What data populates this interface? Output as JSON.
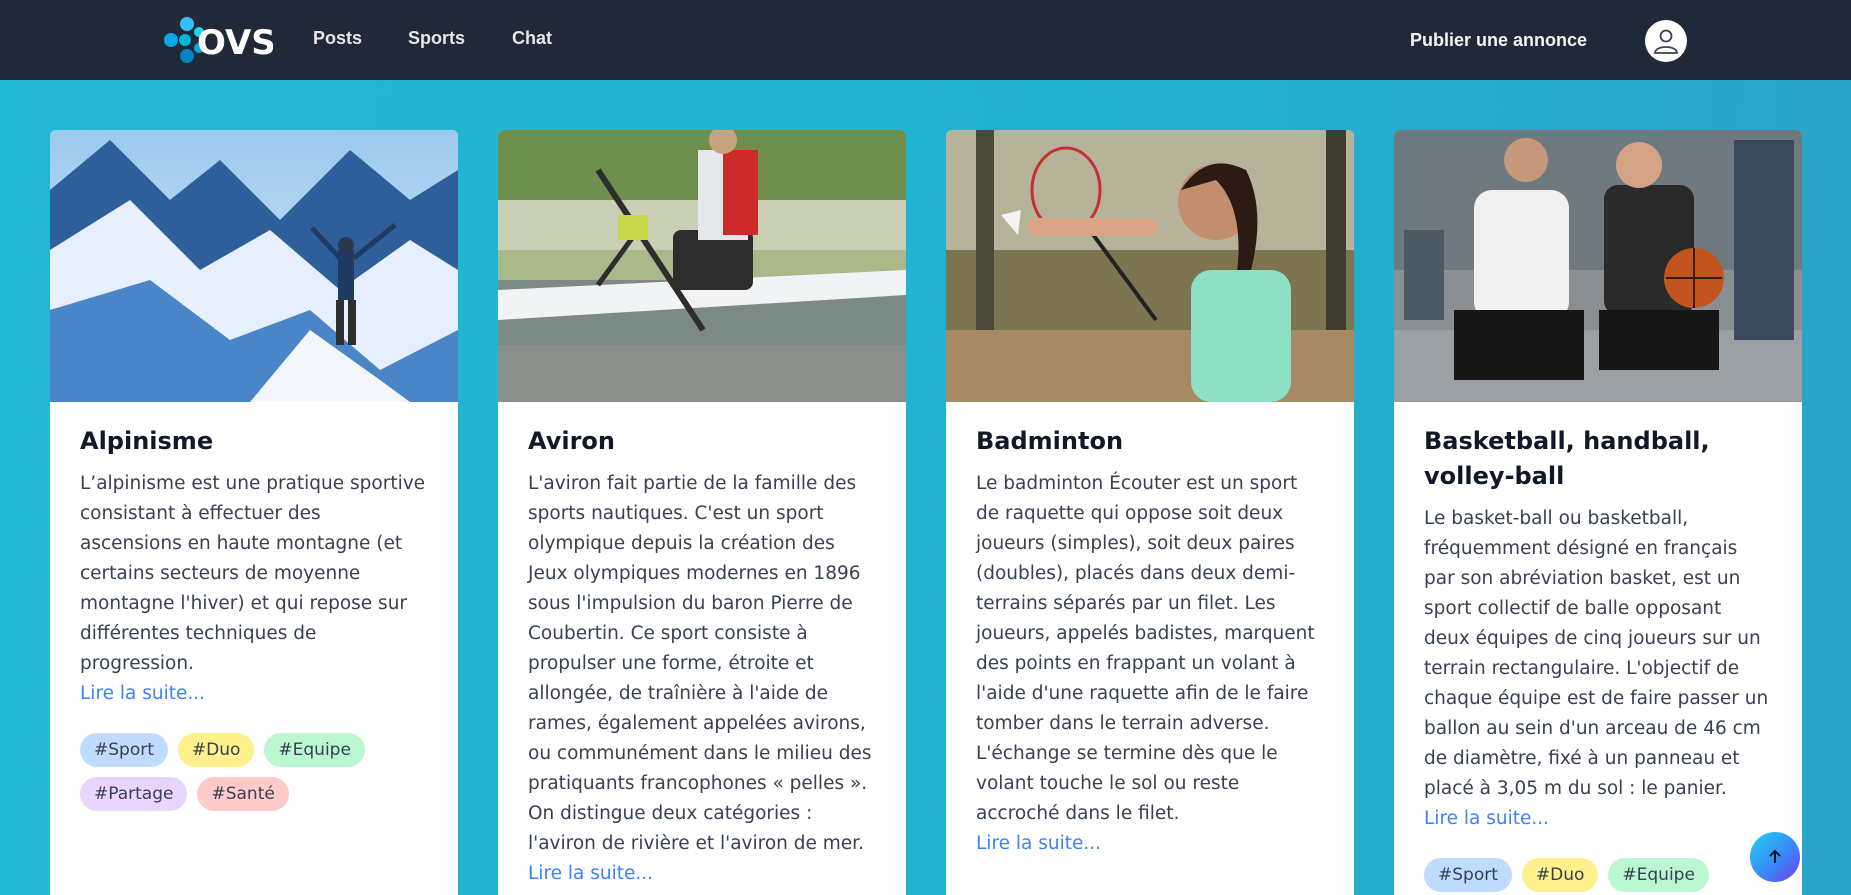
{
  "navbar": {
    "logo_text": "OVS",
    "links": [
      "Posts",
      "Sports",
      "Chat"
    ],
    "publish_label": "Publier une annonce",
    "avatar_icon": "user-icon"
  },
  "cards": [
    {
      "title": "Alpinisme",
      "text": "L’alpinisme est une pratique sportive consistant à effectuer des ascensions en haute montagne (et certains secteurs de moyenne montagne l'hiver) et qui repose sur différentes techniques de progression.",
      "read_more": "Lire la suite...",
      "tags": [
        "#Sport",
        "#Duo",
        "#Equipe",
        "#Partage",
        "#Santé"
      ]
    },
    {
      "title": "Aviron",
      "text": "L'aviron fait partie de la famille des sports nautiques. C'est un sport olympique depuis la création des Jeux olympiques modernes en 1896 sous l'impulsion du baron Pierre de Coubertin. Ce sport consiste à propulser une forme, étroite et allongée, de traînière à l'aide de rames, également appelées avirons, ou communément dans le milieu des pratiquants francophones « pelles ». On distingue deux catégories : l'aviron de rivière et l'aviron de mer.",
      "read_more": "Lire la suite..."
    },
    {
      "title": "Badminton",
      "text": "Le badminton Écouter est un sport de raquette qui oppose soit deux joueurs (simples), soit deux paires (doubles), placés dans deux demi-terrains séparés par un filet. Les joueurs, appelés badistes, marquent des points en frappant un volant à l'aide d'une raquette afin de le faire tomber dans le terrain adverse. L'échange se termine dès que le volant touche le sol ou reste accroché dans le filet.",
      "read_more": "Lire la suite..."
    },
    {
      "title": "Basketball, handball, volley-ball",
      "text": "Le basket-ball ou basketball, fréquemment désigné en français par son abréviation basket, est un sport collectif de balle opposant deux équipes de cinq joueurs sur un terrain rectangulaire. L'objectif de chaque équipe est de faire passer un ballon au sein d'un arceau de 46 cm de diamètre, fixé à un panneau et placé à 3,05 m du sol : le panier.",
      "read_more": "Lire la suite...",
      "tags": [
        "#Sport",
        "#Duo",
        "#Equipe"
      ]
    }
  ],
  "scroll_top_icon": "arrow-up-icon"
}
